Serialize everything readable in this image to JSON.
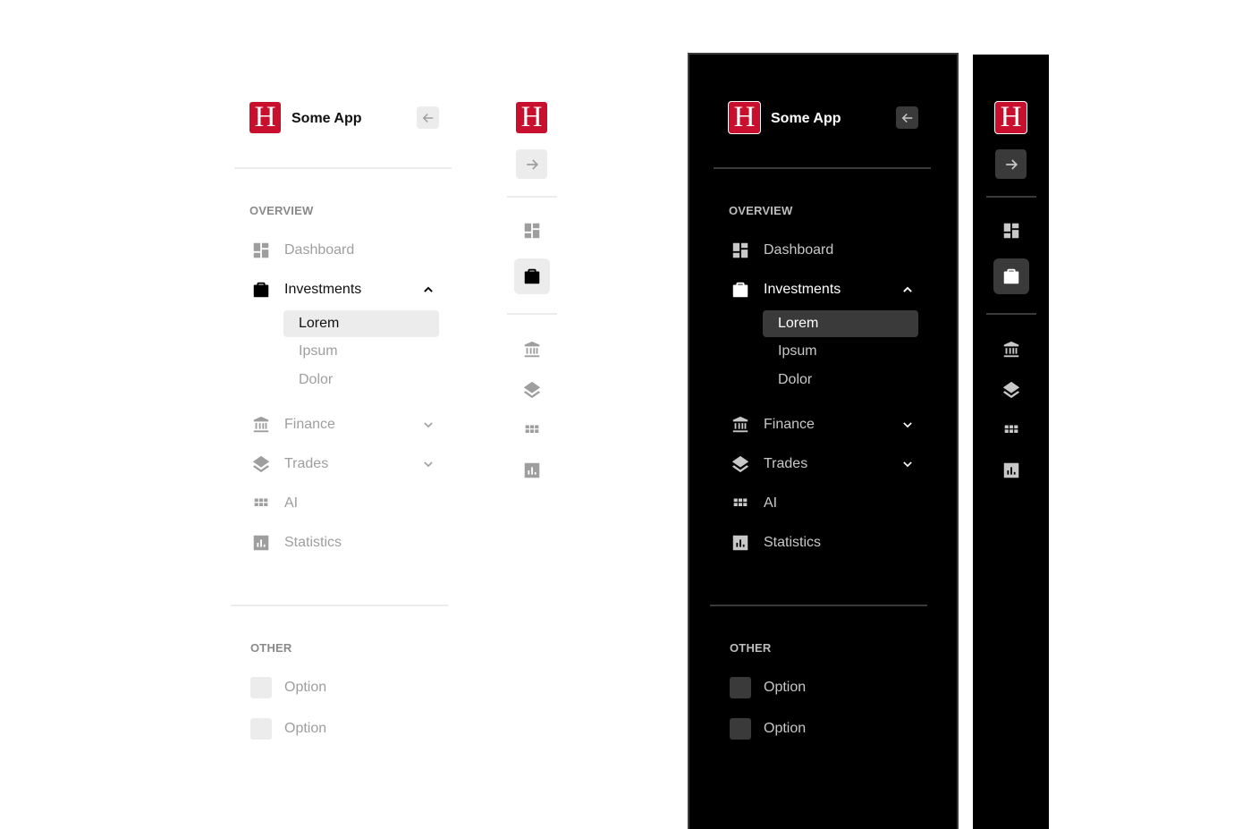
{
  "brand": {
    "logo_letter": "H",
    "app_name": "Some App",
    "logo_color": "#c8102e"
  },
  "sections": {
    "overview_label": "OVERVIEW",
    "other_label": "OTHER"
  },
  "nav": {
    "dashboard": {
      "label": "Dashboard",
      "icon": "dashboard-icon"
    },
    "investments": {
      "label": "Investments",
      "icon": "briefcase-icon",
      "expanded": true,
      "children": [
        "Lorem",
        "Ipsum",
        "Dolor"
      ],
      "selected_child": "Lorem"
    },
    "finance": {
      "label": "Finance",
      "icon": "bank-icon"
    },
    "trades": {
      "label": "Trades",
      "icon": "layers-icon"
    },
    "ai": {
      "label": "AI",
      "icon": "grid-icon"
    },
    "statistics": {
      "label": "Statistics",
      "icon": "bar-chart-icon"
    }
  },
  "other": {
    "option1": "Option",
    "option2": "Option"
  },
  "themes": {
    "light": {
      "background": "#ffffff",
      "selected_bg": "#ececec",
      "button_bg": "#ececec",
      "icon_muted": "#9e9e9e",
      "icon_active": "#000000"
    },
    "dark": {
      "background": "#000000",
      "selected_bg": "#3a3a3a",
      "button_bg": "#3a3a3a",
      "icon_muted": "#c8c8c8",
      "icon_active": "#ffffff"
    }
  }
}
